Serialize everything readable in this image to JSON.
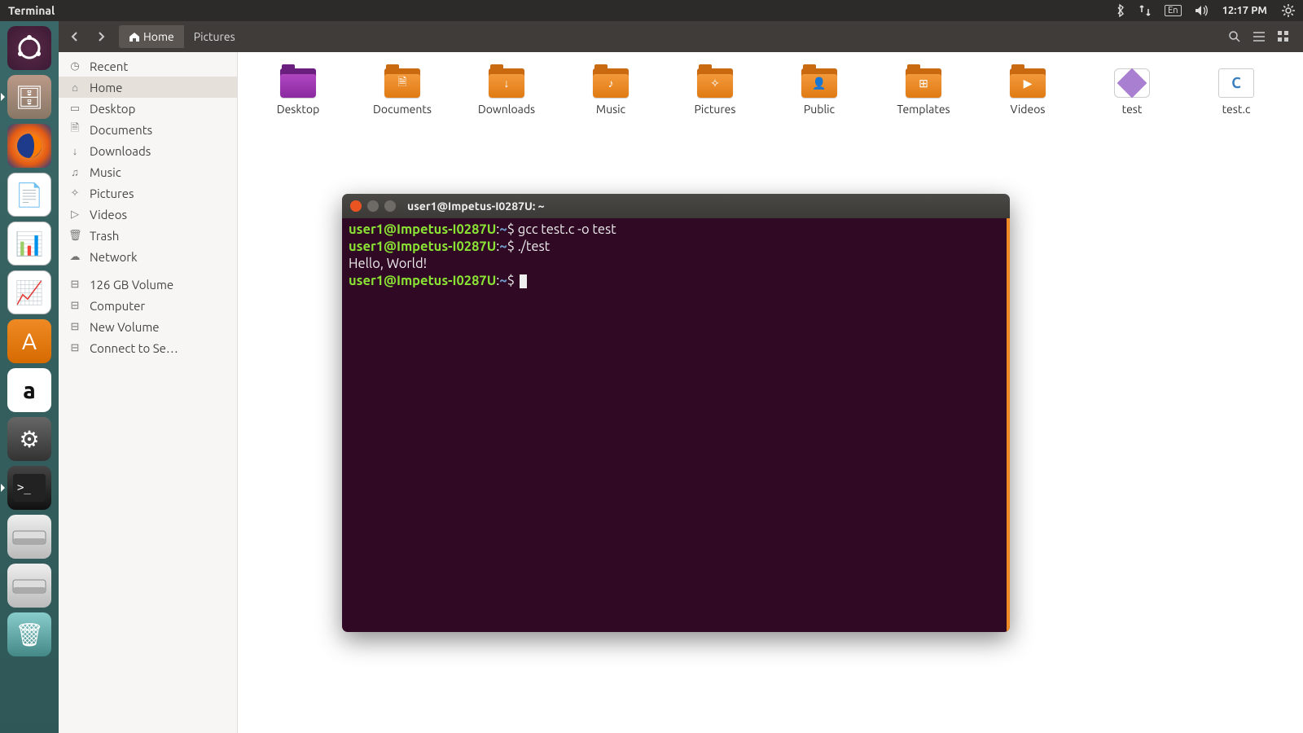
{
  "panel": {
    "app_name": "Terminal",
    "indicators": {
      "lang": "En",
      "time": "12:17 PM"
    }
  },
  "launcher": [
    {
      "name": "ubuntu-dash",
      "glyph": "◌",
      "running": false
    },
    {
      "name": "files",
      "glyph": "🗄",
      "running": true
    },
    {
      "name": "firefox",
      "glyph": "",
      "running": false
    },
    {
      "name": "libreoffice-writer",
      "glyph": "📄",
      "running": false
    },
    {
      "name": "libreoffice-calc",
      "glyph": "📊",
      "running": false
    },
    {
      "name": "libreoffice-impress",
      "glyph": "📈",
      "running": false
    },
    {
      "name": "ubuntu-software",
      "glyph": "A",
      "running": false
    },
    {
      "name": "amazon",
      "glyph": "a",
      "running": false
    },
    {
      "name": "system-settings",
      "glyph": "⚙",
      "running": false
    },
    {
      "name": "terminal",
      "glyph": ">_",
      "running": true
    },
    {
      "name": "drive-1",
      "glyph": "",
      "running": false
    },
    {
      "name": "drive-2",
      "glyph": "",
      "running": false
    },
    {
      "name": "trash",
      "glyph": "🗑",
      "running": false
    }
  ],
  "nautilus": {
    "breadcrumbs": [
      {
        "label": "Home",
        "active": true,
        "icon": "home"
      },
      {
        "label": "Pictures",
        "active": false
      }
    ],
    "sidebar": [
      {
        "icon": "◷",
        "label": "Recent",
        "sel": false
      },
      {
        "icon": "⌂",
        "label": "Home",
        "sel": true
      },
      {
        "icon": "▭",
        "label": "Desktop",
        "sel": false
      },
      {
        "icon": "🗎",
        "label": "Documents",
        "sel": false
      },
      {
        "icon": "↓",
        "label": "Downloads",
        "sel": false
      },
      {
        "icon": "♫",
        "label": "Music",
        "sel": false
      },
      {
        "icon": "✧",
        "label": "Pictures",
        "sel": false
      },
      {
        "icon": "▷",
        "label": "Videos",
        "sel": false
      },
      {
        "icon": "🗑",
        "label": "Trash",
        "sel": false
      },
      {
        "icon": "☁",
        "label": "Network",
        "sel": false
      },
      {
        "gap": true
      },
      {
        "icon": "⊟",
        "label": "126 GB Volume",
        "sel": false
      },
      {
        "icon": "⊟",
        "label": "Computer",
        "sel": false
      },
      {
        "icon": "⊟",
        "label": "New Volume",
        "sel": false
      },
      {
        "icon": "⊟",
        "label": "Connect to Se…",
        "sel": false
      }
    ],
    "items": [
      {
        "type": "folder-desktop",
        "label": "Desktop",
        "emb": ""
      },
      {
        "type": "folder",
        "label": "Documents",
        "emb": "🗎"
      },
      {
        "type": "folder",
        "label": "Downloads",
        "emb": "↓"
      },
      {
        "type": "folder",
        "label": "Music",
        "emb": "♪"
      },
      {
        "type": "folder",
        "label": "Pictures",
        "emb": "✧"
      },
      {
        "type": "folder",
        "label": "Public",
        "emb": "👤"
      },
      {
        "type": "folder",
        "label": "Templates",
        "emb": "⊞"
      },
      {
        "type": "folder",
        "label": "Videos",
        "emb": "▶"
      },
      {
        "type": "testapp",
        "label": "test"
      },
      {
        "type": "cfile",
        "label": "test.c"
      }
    ]
  },
  "terminal": {
    "title": "user1@Impetus-I0287U: ~",
    "prompt": {
      "user": "user1",
      "host": "Impetus-I0287U",
      "cwd": "~"
    },
    "lines": [
      {
        "kind": "cmd",
        "text": "gcc test.c -o test"
      },
      {
        "kind": "cmd",
        "text": "./test"
      },
      {
        "kind": "out",
        "text": "Hello, World!"
      },
      {
        "kind": "cmd",
        "text": ""
      }
    ]
  }
}
